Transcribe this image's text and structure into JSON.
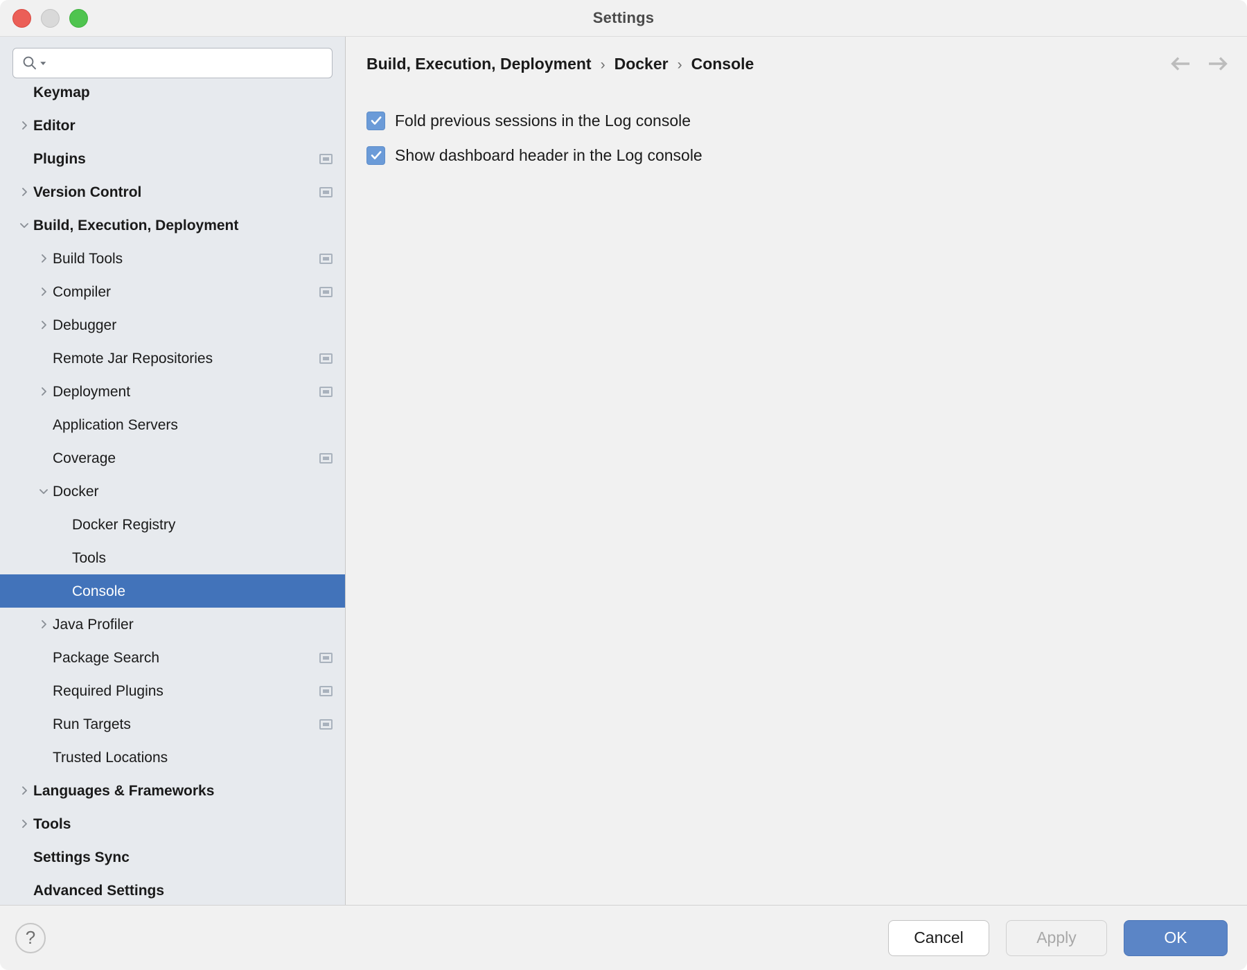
{
  "window": {
    "title": "Settings",
    "traffic_lights": [
      "close",
      "minimize",
      "maximize"
    ]
  },
  "search": {
    "value": "",
    "placeholder": "",
    "icon": "search-icon"
  },
  "sidebar": {
    "items": [
      {
        "label": "Keymap",
        "level": 0,
        "bold": true,
        "twisty": "none",
        "badge": false,
        "selected": false
      },
      {
        "label": "Editor",
        "level": 0,
        "bold": true,
        "twisty": "collapsed",
        "badge": false,
        "selected": false
      },
      {
        "label": "Plugins",
        "level": 0,
        "bold": true,
        "twisty": "none",
        "badge": true,
        "selected": false
      },
      {
        "label": "Version Control",
        "level": 0,
        "bold": true,
        "twisty": "collapsed",
        "badge": true,
        "selected": false
      },
      {
        "label": "Build, Execution, Deployment",
        "level": 0,
        "bold": true,
        "twisty": "expanded",
        "badge": false,
        "selected": false
      },
      {
        "label": "Build Tools",
        "level": 1,
        "bold": false,
        "twisty": "collapsed",
        "badge": true,
        "selected": false
      },
      {
        "label": "Compiler",
        "level": 1,
        "bold": false,
        "twisty": "collapsed",
        "badge": true,
        "selected": false
      },
      {
        "label": "Debugger",
        "level": 1,
        "bold": false,
        "twisty": "collapsed",
        "badge": false,
        "selected": false
      },
      {
        "label": "Remote Jar Repositories",
        "level": 1,
        "bold": false,
        "twisty": "none",
        "badge": true,
        "selected": false
      },
      {
        "label": "Deployment",
        "level": 1,
        "bold": false,
        "twisty": "collapsed",
        "badge": true,
        "selected": false
      },
      {
        "label": "Application Servers",
        "level": 1,
        "bold": false,
        "twisty": "none",
        "badge": false,
        "selected": false
      },
      {
        "label": "Coverage",
        "level": 1,
        "bold": false,
        "twisty": "none",
        "badge": true,
        "selected": false
      },
      {
        "label": "Docker",
        "level": 1,
        "bold": false,
        "twisty": "expanded",
        "badge": false,
        "selected": false
      },
      {
        "label": "Docker Registry",
        "level": 2,
        "bold": false,
        "twisty": "none",
        "badge": false,
        "selected": false
      },
      {
        "label": "Tools",
        "level": 2,
        "bold": false,
        "twisty": "none",
        "badge": false,
        "selected": false
      },
      {
        "label": "Console",
        "level": 2,
        "bold": false,
        "twisty": "none",
        "badge": false,
        "selected": true
      },
      {
        "label": "Java Profiler",
        "level": 1,
        "bold": false,
        "twisty": "collapsed",
        "badge": false,
        "selected": false
      },
      {
        "label": "Package Search",
        "level": 1,
        "bold": false,
        "twisty": "none",
        "badge": true,
        "selected": false
      },
      {
        "label": "Required Plugins",
        "level": 1,
        "bold": false,
        "twisty": "none",
        "badge": true,
        "selected": false
      },
      {
        "label": "Run Targets",
        "level": 1,
        "bold": false,
        "twisty": "none",
        "badge": true,
        "selected": false
      },
      {
        "label": "Trusted Locations",
        "level": 1,
        "bold": false,
        "twisty": "none",
        "badge": false,
        "selected": false
      },
      {
        "label": "Languages & Frameworks",
        "level": 0,
        "bold": true,
        "twisty": "collapsed",
        "badge": false,
        "selected": false
      },
      {
        "label": "Tools",
        "level": 0,
        "bold": true,
        "twisty": "collapsed",
        "badge": false,
        "selected": false
      },
      {
        "label": "Settings Sync",
        "level": 0,
        "bold": true,
        "twisty": "none",
        "badge": false,
        "selected": false
      },
      {
        "label": "Advanced Settings",
        "level": 0,
        "bold": true,
        "twisty": "none",
        "badge": false,
        "selected": false
      }
    ]
  },
  "breadcrumb": {
    "separator": "›",
    "crumbs": [
      "Build, Execution, Deployment",
      "Docker",
      "Console"
    ]
  },
  "nav": {
    "back_icon": "arrow-left-icon",
    "forward_icon": "arrow-right-icon"
  },
  "content": {
    "checkboxes": [
      {
        "label": "Fold previous sessions in the Log console",
        "checked": true
      },
      {
        "label": "Show dashboard header in the Log console",
        "checked": true
      }
    ]
  },
  "footer": {
    "help_label": "?",
    "cancel_label": "Cancel",
    "apply_label": "Apply",
    "ok_label": "OK",
    "apply_disabled": true
  },
  "colors": {
    "selection_blue": "#4273ba",
    "accent_blue": "#5b85c6",
    "checkbox_blue": "#6b9bd8",
    "sidebar_bg": "#e7eaee",
    "panel_bg": "#f1f1f1"
  }
}
